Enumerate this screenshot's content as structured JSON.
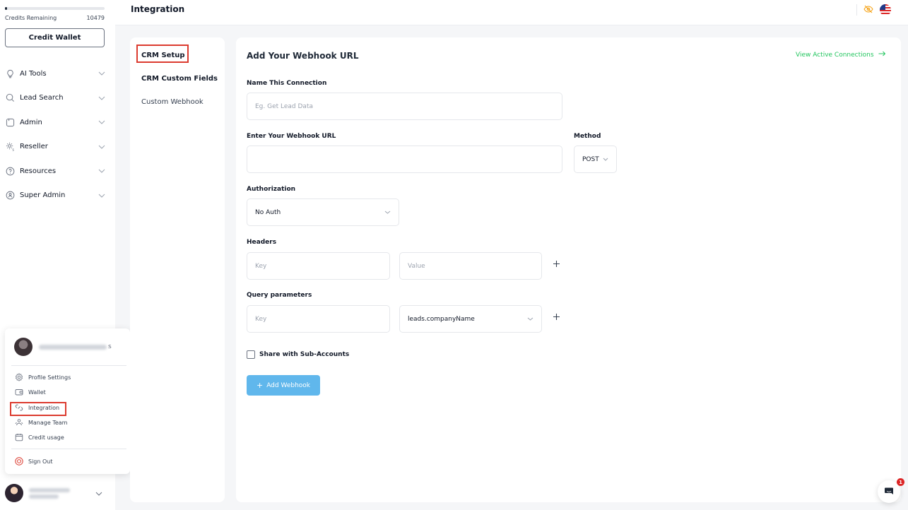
{
  "sidebar": {
    "credits_label": "Credits Remaining",
    "credits_value": "10479",
    "credits_progress": 0.02,
    "credit_wallet_label": "Credit Wallet",
    "nav": [
      {
        "label": "AI Tools",
        "icon": "lightbulb-icon"
      },
      {
        "label": "Lead Search",
        "icon": "search-icon"
      },
      {
        "label": "Admin",
        "icon": "admin-icon"
      },
      {
        "label": "Reseller",
        "icon": "reseller-icon"
      },
      {
        "label": "Resources",
        "icon": "help-icon"
      },
      {
        "label": "Super Admin",
        "icon": "super-admin-icon"
      }
    ]
  },
  "profile_menu": {
    "user_suffix": "s",
    "items": [
      {
        "label": "Profile Settings",
        "icon": "gear-icon"
      },
      {
        "label": "Wallet",
        "icon": "wallet-icon"
      },
      {
        "label": "Integration",
        "icon": "integration-icon"
      },
      {
        "label": "Manage Team",
        "icon": "team-icon"
      },
      {
        "label": "Credit usage",
        "icon": "calendar-icon"
      }
    ],
    "sign_out": "Sign Out"
  },
  "header": {
    "title": "Integration"
  },
  "settings_nav": {
    "items": [
      "CRM Setup",
      "CRM Custom Fields",
      "Custom Webhook"
    ]
  },
  "form": {
    "title": "Add Your Webhook URL",
    "view_connections": "View Active Connections",
    "name_label": "Name This Connection",
    "name_placeholder": "Eg. Get Lead Data",
    "url_label": "Enter Your Webhook URL",
    "url_value": "",
    "method_label": "Method",
    "method_value": "POST",
    "auth_label": "Authorization",
    "auth_value": "No Auth",
    "headers_label": "Headers",
    "header_key_placeholder": "Key",
    "header_value_placeholder": "Value",
    "query_label": "Query parameters",
    "query_key_placeholder": "Key",
    "query_value": "leads.companyName",
    "share_label": "Share with Sub-Accounts",
    "add_button": "Add Webhook"
  },
  "chat": {
    "badge_count": "1"
  },
  "colors": {
    "accent_green": "#22c55e",
    "button_blue": "#60b7ec",
    "highlight_red": "#dc3b2f"
  }
}
